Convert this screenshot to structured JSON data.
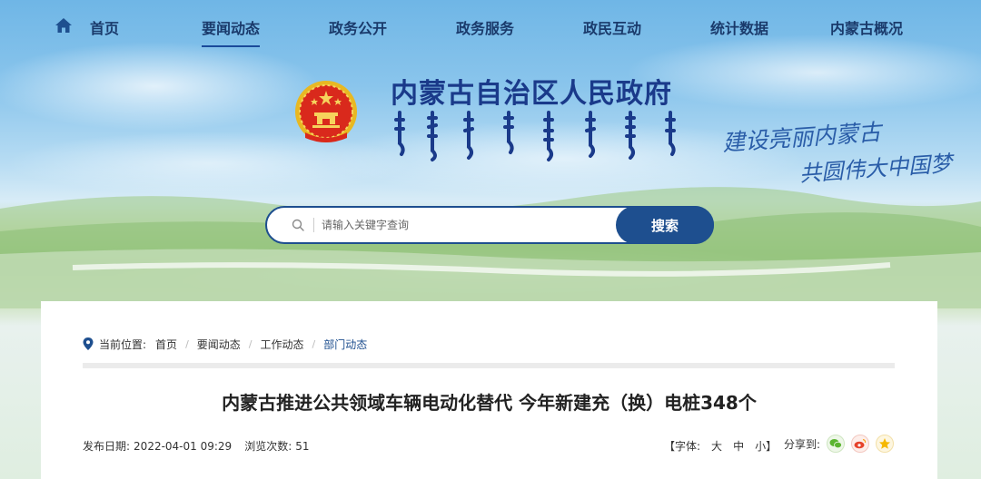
{
  "nav": {
    "items": [
      {
        "label": "首页"
      },
      {
        "label": "要闻动态"
      },
      {
        "label": "政务公开"
      },
      {
        "label": "政务服务"
      },
      {
        "label": "政民互动"
      },
      {
        "label": "统计数据"
      },
      {
        "label": "内蒙古概况"
      }
    ],
    "active_index": 1
  },
  "header": {
    "site_title": "内蒙古自治区人民政府",
    "slogan_line1": "建设亮丽内蒙古",
    "slogan_line2": "共圆伟大中国梦"
  },
  "search": {
    "placeholder": "请输入关键字查询",
    "value": "",
    "button_label": "搜索"
  },
  "breadcrumb": {
    "label": "当前位置:",
    "items": [
      "首页",
      "要闻动态",
      "工作动态",
      "部门动态"
    ],
    "separator": "/"
  },
  "article": {
    "title": "内蒙古推进公共领域车辆电动化替代 今年新建充（换）电桩348个",
    "publish_date_label": "发布日期:",
    "publish_date": "2022-04-01 09:29",
    "views_label": "浏览次数:",
    "views": "51",
    "font_label": "【字体:",
    "font_large": "大",
    "font_medium": "中",
    "font_small": "小",
    "font_close": "】",
    "share_label": "分享到:"
  },
  "colors": {
    "primary": "#1e4f8f",
    "nav_text": "#1a3a6b",
    "title_blue": "#1a3a8a",
    "wechat": "#5cb531",
    "weibo": "#e6432c",
    "qzone": "#f5b800"
  },
  "icons": [
    "home-icon",
    "search-icon",
    "location-pin-icon",
    "wechat-icon",
    "weibo-icon",
    "qzone-icon",
    "national-emblem"
  ]
}
